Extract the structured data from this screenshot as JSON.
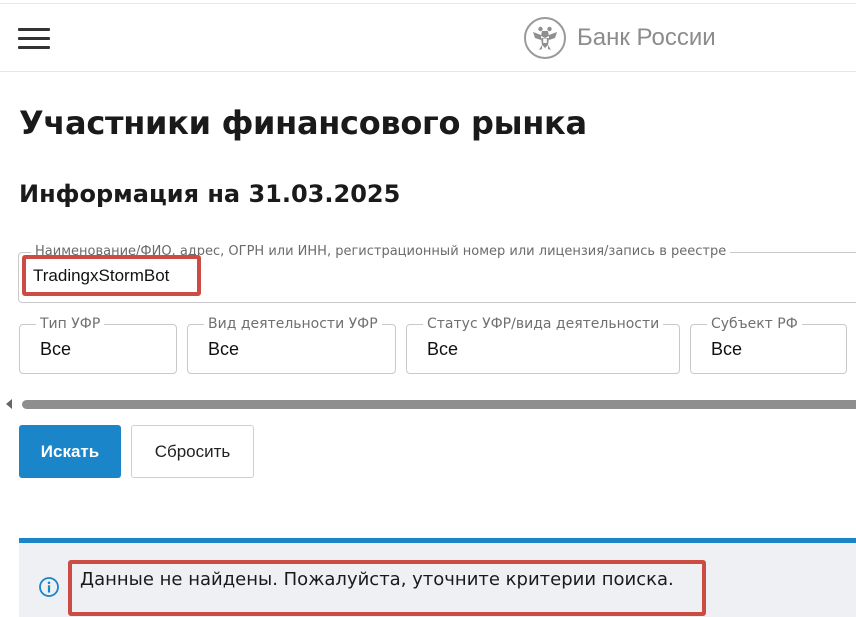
{
  "header": {
    "logo_text": "Банк России",
    "logo_icon": "double-headed-eagle-emblem",
    "menu_icon": "hamburger-menu-icon"
  },
  "page": {
    "title": "Участники финансового рынка",
    "subtitle": "Информация на 31.03.2025"
  },
  "search": {
    "label": "Наименование/ФИО, адрес, ОГРН или ИНН, регистрационный номер или лицензия/запись в реестре",
    "value": "TradingxStormBot"
  },
  "filters": [
    {
      "label": "Тип УФР",
      "value": "Все"
    },
    {
      "label": "Вид деятельности УФР",
      "value": "Все"
    },
    {
      "label": "Статус УФР/вида деятельности",
      "value": "Все"
    },
    {
      "label": "Субъект РФ",
      "value": "Все"
    }
  ],
  "buttons": {
    "search_label": "Искать",
    "reset_label": "Сбросить"
  },
  "alert": {
    "icon": "info-icon",
    "message": "Данные не найдены. Пожалуйста, уточните критерии поиска."
  },
  "colors": {
    "accent": "#1a85c9",
    "highlight": "#cc4b42",
    "alert_bg": "#eef0f3"
  }
}
